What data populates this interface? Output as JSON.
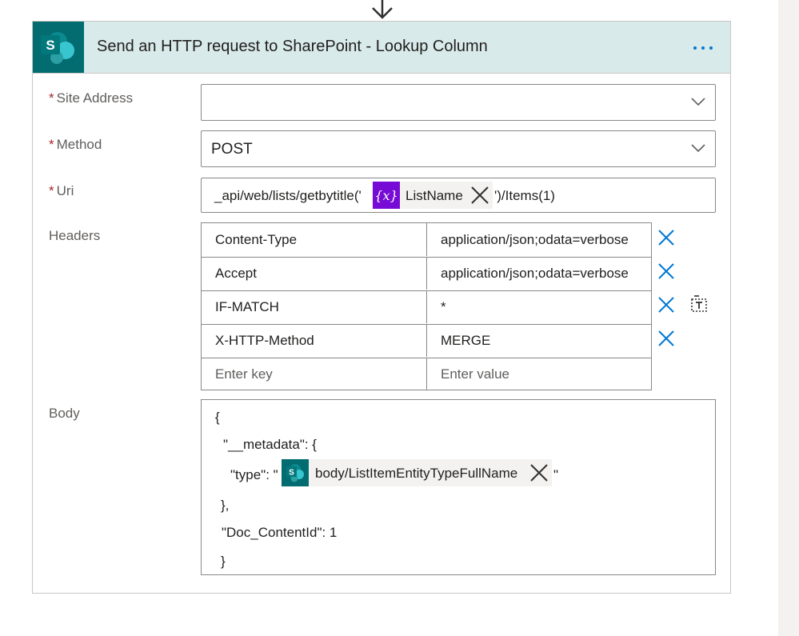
{
  "card": {
    "title": "Send an HTTP request to SharePoint - Lookup Column",
    "logo_letter": "S",
    "brand_color": "#036c70"
  },
  "fields": {
    "site_address": {
      "required_mark": "*",
      "label": "Site Address",
      "value": ""
    },
    "method": {
      "required_mark": "*",
      "label": "Method",
      "value": "POST"
    },
    "uri": {
      "required_mark": "*",
      "label": "Uri",
      "prefix": "_api/web/lists/getbytitle('",
      "token_icon": "{x}",
      "token_label": "ListName",
      "suffix": "')/Items(1)"
    },
    "headers": {
      "label": "Headers",
      "rows": [
        {
          "key": "Content-Type",
          "value": "application/json;odata=verbose"
        },
        {
          "key": "Accept",
          "value": "application/json;odata=verbose"
        },
        {
          "key": "IF-MATCH",
          "value": "*"
        },
        {
          "key": "X-HTTP-Method",
          "value": "MERGE"
        }
      ],
      "key_placeholder": "Enter key",
      "value_placeholder": "Enter value"
    },
    "body": {
      "label": "Body",
      "line1": "{",
      "line2": "\"__metadata\": {",
      "line3_prefix": "\"type\": \"",
      "token_label": "body/ListItemEntityTypeFullName",
      "line3_suffix": "\"",
      "line4": "},",
      "line5": "\"Doc_ContentId\": 1",
      "line6": "}"
    }
  },
  "colors": {
    "header_bg": "#d9eaea",
    "accent": "#0078d4",
    "variable_token": "#770bd6",
    "required": "#a4262c"
  },
  "icons": [
    "down-arrow-icon",
    "sharepoint-logo-icon",
    "more-options-icon",
    "chevron-down-icon",
    "variable-icon",
    "remove-token-icon",
    "delete-row-icon",
    "switch-to-text-mode-icon"
  ]
}
